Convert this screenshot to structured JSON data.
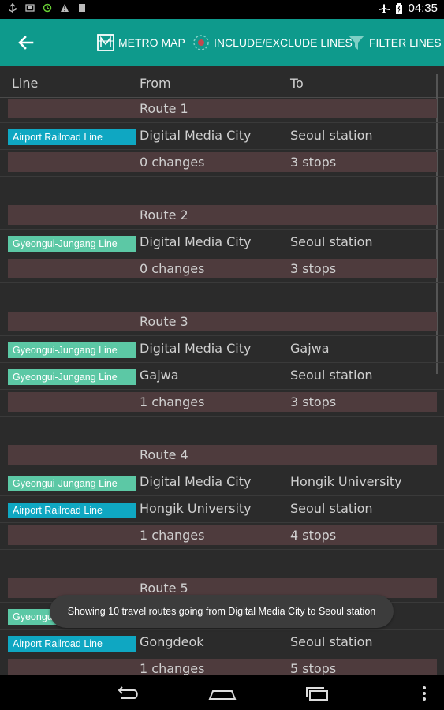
{
  "status": {
    "time": "04:35"
  },
  "actionbar": {
    "metro_map": "METRO MAP",
    "include_exclude": "INCLUDE/EXCLUDE LINES",
    "filter": "FILTER LINES"
  },
  "table": {
    "headers": {
      "line": "Line",
      "from": "From",
      "to": "To"
    }
  },
  "colors": {
    "airport": "#0fa7c2",
    "gyeongui": "#5cc8a5",
    "actionbar": "#0e9a8c",
    "cell_shade": "#4e3b3d"
  },
  "routes": [
    {
      "title": "Route 1",
      "legs": [
        {
          "line": "Airport Railroad Line",
          "line_color": "#0fa7c2",
          "from": "Digital Media City",
          "to": "Seoul station"
        }
      ],
      "changes": "0 changes",
      "stops": "3 stops"
    },
    {
      "title": "Route 2",
      "legs": [
        {
          "line": "Gyeongui-Jungang Line",
          "line_color": "#5cc8a5",
          "from": "Digital Media City",
          "to": "Seoul station"
        }
      ],
      "changes": "0 changes",
      "stops": "3 stops"
    },
    {
      "title": "Route 3",
      "legs": [
        {
          "line": "Gyeongui-Jungang Line",
          "line_color": "#5cc8a5",
          "from": "Digital Media City",
          "to": "Gajwa"
        },
        {
          "line": "Gyeongui-Jungang Line",
          "line_color": "#5cc8a5",
          "from": "Gajwa",
          "to": "Seoul station"
        }
      ],
      "changes": "1 changes",
      "stops": "3 stops"
    },
    {
      "title": "Route 4",
      "legs": [
        {
          "line": "Gyeongui-Jungang Line",
          "line_color": "#5cc8a5",
          "from": "Digital Media City",
          "to": "Hongik University"
        },
        {
          "line": "Airport Railroad Line",
          "line_color": "#0fa7c2",
          "from": "Hongik University",
          "to": "Seoul station"
        }
      ],
      "changes": "1 changes",
      "stops": "4 stops"
    },
    {
      "title": "Route 5",
      "legs": [
        {
          "line": "Gyeongui-Jungang Line",
          "line_color": "#5cc8a5",
          "from": "",
          "to": ""
        },
        {
          "line": "Airport Railroad Line",
          "line_color": "#0fa7c2",
          "from": "Gongdeok",
          "to": "Seoul station"
        }
      ],
      "changes": "1 changes",
      "stops": "5 stops"
    }
  ],
  "toast": "Showing 10 travel routes going from Digital Media City to Seoul station"
}
